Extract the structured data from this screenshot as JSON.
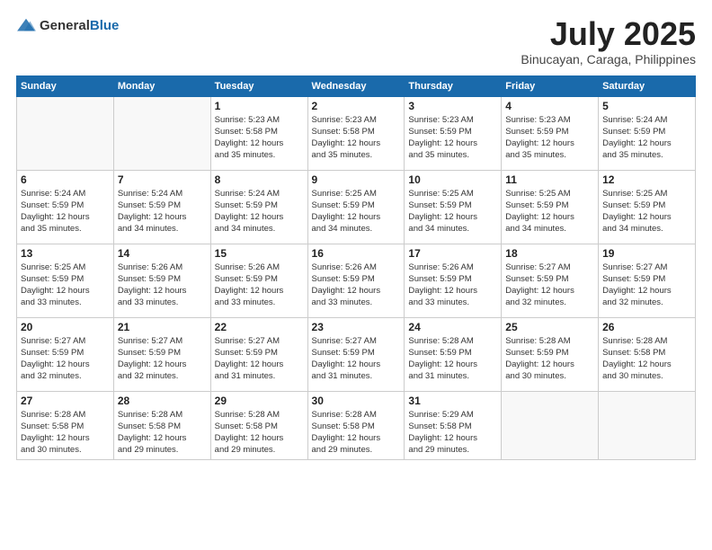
{
  "header": {
    "logo_general": "General",
    "logo_blue": "Blue",
    "title": "July 2025",
    "location": "Binucayan, Caraga, Philippines"
  },
  "weekdays": [
    "Sunday",
    "Monday",
    "Tuesday",
    "Wednesday",
    "Thursday",
    "Friday",
    "Saturday"
  ],
  "weeks": [
    [
      {
        "day": "",
        "info": ""
      },
      {
        "day": "",
        "info": ""
      },
      {
        "day": "1",
        "info": "Sunrise: 5:23 AM\nSunset: 5:58 PM\nDaylight: 12 hours\nand 35 minutes."
      },
      {
        "day": "2",
        "info": "Sunrise: 5:23 AM\nSunset: 5:58 PM\nDaylight: 12 hours\nand 35 minutes."
      },
      {
        "day": "3",
        "info": "Sunrise: 5:23 AM\nSunset: 5:59 PM\nDaylight: 12 hours\nand 35 minutes."
      },
      {
        "day": "4",
        "info": "Sunrise: 5:23 AM\nSunset: 5:59 PM\nDaylight: 12 hours\nand 35 minutes."
      },
      {
        "day": "5",
        "info": "Sunrise: 5:24 AM\nSunset: 5:59 PM\nDaylight: 12 hours\nand 35 minutes."
      }
    ],
    [
      {
        "day": "6",
        "info": "Sunrise: 5:24 AM\nSunset: 5:59 PM\nDaylight: 12 hours\nand 35 minutes."
      },
      {
        "day": "7",
        "info": "Sunrise: 5:24 AM\nSunset: 5:59 PM\nDaylight: 12 hours\nand 34 minutes."
      },
      {
        "day": "8",
        "info": "Sunrise: 5:24 AM\nSunset: 5:59 PM\nDaylight: 12 hours\nand 34 minutes."
      },
      {
        "day": "9",
        "info": "Sunrise: 5:25 AM\nSunset: 5:59 PM\nDaylight: 12 hours\nand 34 minutes."
      },
      {
        "day": "10",
        "info": "Sunrise: 5:25 AM\nSunset: 5:59 PM\nDaylight: 12 hours\nand 34 minutes."
      },
      {
        "day": "11",
        "info": "Sunrise: 5:25 AM\nSunset: 5:59 PM\nDaylight: 12 hours\nand 34 minutes."
      },
      {
        "day": "12",
        "info": "Sunrise: 5:25 AM\nSunset: 5:59 PM\nDaylight: 12 hours\nand 34 minutes."
      }
    ],
    [
      {
        "day": "13",
        "info": "Sunrise: 5:25 AM\nSunset: 5:59 PM\nDaylight: 12 hours\nand 33 minutes."
      },
      {
        "day": "14",
        "info": "Sunrise: 5:26 AM\nSunset: 5:59 PM\nDaylight: 12 hours\nand 33 minutes."
      },
      {
        "day": "15",
        "info": "Sunrise: 5:26 AM\nSunset: 5:59 PM\nDaylight: 12 hours\nand 33 minutes."
      },
      {
        "day": "16",
        "info": "Sunrise: 5:26 AM\nSunset: 5:59 PM\nDaylight: 12 hours\nand 33 minutes."
      },
      {
        "day": "17",
        "info": "Sunrise: 5:26 AM\nSunset: 5:59 PM\nDaylight: 12 hours\nand 33 minutes."
      },
      {
        "day": "18",
        "info": "Sunrise: 5:27 AM\nSunset: 5:59 PM\nDaylight: 12 hours\nand 32 minutes."
      },
      {
        "day": "19",
        "info": "Sunrise: 5:27 AM\nSunset: 5:59 PM\nDaylight: 12 hours\nand 32 minutes."
      }
    ],
    [
      {
        "day": "20",
        "info": "Sunrise: 5:27 AM\nSunset: 5:59 PM\nDaylight: 12 hours\nand 32 minutes."
      },
      {
        "day": "21",
        "info": "Sunrise: 5:27 AM\nSunset: 5:59 PM\nDaylight: 12 hours\nand 32 minutes."
      },
      {
        "day": "22",
        "info": "Sunrise: 5:27 AM\nSunset: 5:59 PM\nDaylight: 12 hours\nand 31 minutes."
      },
      {
        "day": "23",
        "info": "Sunrise: 5:27 AM\nSunset: 5:59 PM\nDaylight: 12 hours\nand 31 minutes."
      },
      {
        "day": "24",
        "info": "Sunrise: 5:28 AM\nSunset: 5:59 PM\nDaylight: 12 hours\nand 31 minutes."
      },
      {
        "day": "25",
        "info": "Sunrise: 5:28 AM\nSunset: 5:59 PM\nDaylight: 12 hours\nand 30 minutes."
      },
      {
        "day": "26",
        "info": "Sunrise: 5:28 AM\nSunset: 5:58 PM\nDaylight: 12 hours\nand 30 minutes."
      }
    ],
    [
      {
        "day": "27",
        "info": "Sunrise: 5:28 AM\nSunset: 5:58 PM\nDaylight: 12 hours\nand 30 minutes."
      },
      {
        "day": "28",
        "info": "Sunrise: 5:28 AM\nSunset: 5:58 PM\nDaylight: 12 hours\nand 29 minutes."
      },
      {
        "day": "29",
        "info": "Sunrise: 5:28 AM\nSunset: 5:58 PM\nDaylight: 12 hours\nand 29 minutes."
      },
      {
        "day": "30",
        "info": "Sunrise: 5:28 AM\nSunset: 5:58 PM\nDaylight: 12 hours\nand 29 minutes."
      },
      {
        "day": "31",
        "info": "Sunrise: 5:29 AM\nSunset: 5:58 PM\nDaylight: 12 hours\nand 29 minutes."
      },
      {
        "day": "",
        "info": ""
      },
      {
        "day": "",
        "info": ""
      }
    ]
  ]
}
